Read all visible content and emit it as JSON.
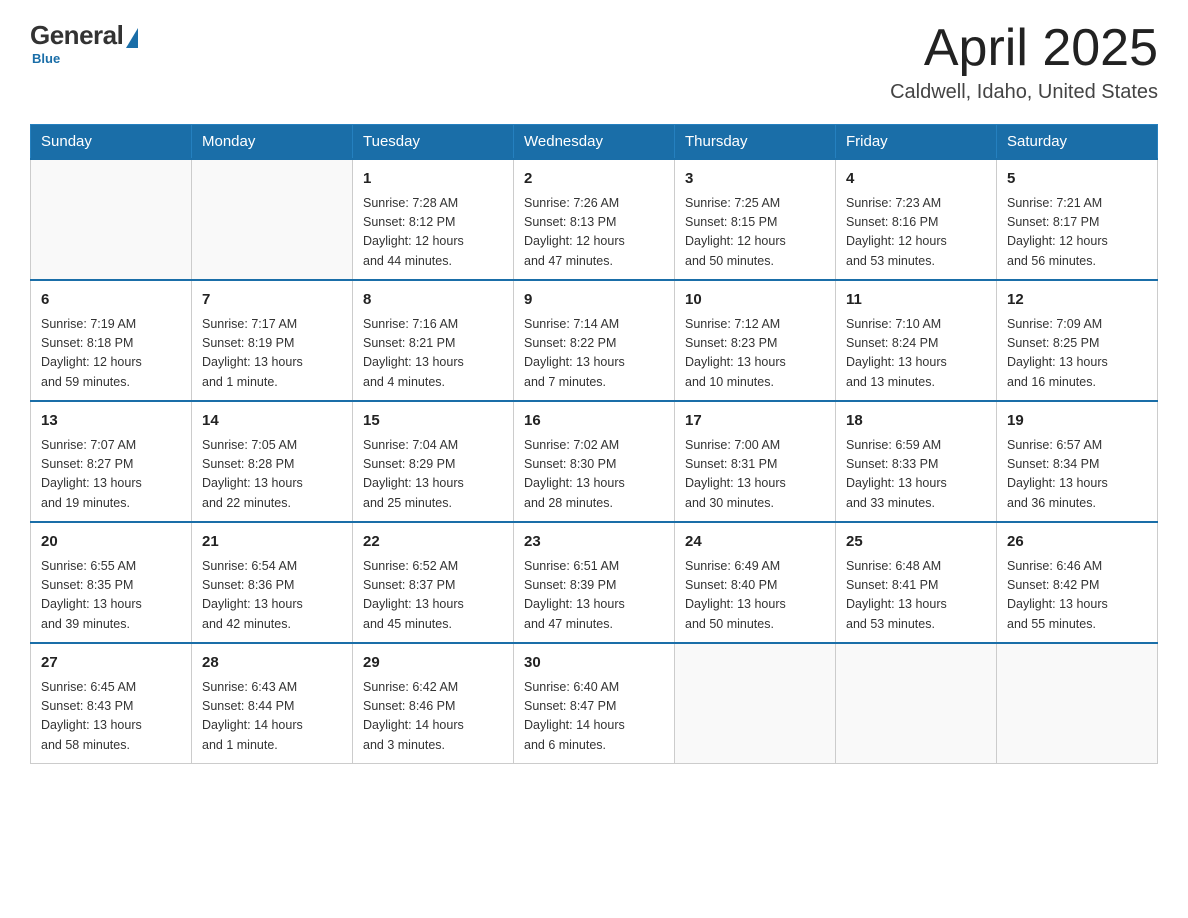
{
  "logo": {
    "general": "General",
    "blue": "Blue",
    "subtitle": "Blue"
  },
  "title": {
    "month_year": "April 2025",
    "location": "Caldwell, Idaho, United States"
  },
  "headers": [
    "Sunday",
    "Monday",
    "Tuesday",
    "Wednesday",
    "Thursday",
    "Friday",
    "Saturday"
  ],
  "weeks": [
    [
      {
        "day": "",
        "info": ""
      },
      {
        "day": "",
        "info": ""
      },
      {
        "day": "1",
        "info": "Sunrise: 7:28 AM\nSunset: 8:12 PM\nDaylight: 12 hours\nand 44 minutes."
      },
      {
        "day": "2",
        "info": "Sunrise: 7:26 AM\nSunset: 8:13 PM\nDaylight: 12 hours\nand 47 minutes."
      },
      {
        "day": "3",
        "info": "Sunrise: 7:25 AM\nSunset: 8:15 PM\nDaylight: 12 hours\nand 50 minutes."
      },
      {
        "day": "4",
        "info": "Sunrise: 7:23 AM\nSunset: 8:16 PM\nDaylight: 12 hours\nand 53 minutes."
      },
      {
        "day": "5",
        "info": "Sunrise: 7:21 AM\nSunset: 8:17 PM\nDaylight: 12 hours\nand 56 minutes."
      }
    ],
    [
      {
        "day": "6",
        "info": "Sunrise: 7:19 AM\nSunset: 8:18 PM\nDaylight: 12 hours\nand 59 minutes."
      },
      {
        "day": "7",
        "info": "Sunrise: 7:17 AM\nSunset: 8:19 PM\nDaylight: 13 hours\nand 1 minute."
      },
      {
        "day": "8",
        "info": "Sunrise: 7:16 AM\nSunset: 8:21 PM\nDaylight: 13 hours\nand 4 minutes."
      },
      {
        "day": "9",
        "info": "Sunrise: 7:14 AM\nSunset: 8:22 PM\nDaylight: 13 hours\nand 7 minutes."
      },
      {
        "day": "10",
        "info": "Sunrise: 7:12 AM\nSunset: 8:23 PM\nDaylight: 13 hours\nand 10 minutes."
      },
      {
        "day": "11",
        "info": "Sunrise: 7:10 AM\nSunset: 8:24 PM\nDaylight: 13 hours\nand 13 minutes."
      },
      {
        "day": "12",
        "info": "Sunrise: 7:09 AM\nSunset: 8:25 PM\nDaylight: 13 hours\nand 16 minutes."
      }
    ],
    [
      {
        "day": "13",
        "info": "Sunrise: 7:07 AM\nSunset: 8:27 PM\nDaylight: 13 hours\nand 19 minutes."
      },
      {
        "day": "14",
        "info": "Sunrise: 7:05 AM\nSunset: 8:28 PM\nDaylight: 13 hours\nand 22 minutes."
      },
      {
        "day": "15",
        "info": "Sunrise: 7:04 AM\nSunset: 8:29 PM\nDaylight: 13 hours\nand 25 minutes."
      },
      {
        "day": "16",
        "info": "Sunrise: 7:02 AM\nSunset: 8:30 PM\nDaylight: 13 hours\nand 28 minutes."
      },
      {
        "day": "17",
        "info": "Sunrise: 7:00 AM\nSunset: 8:31 PM\nDaylight: 13 hours\nand 30 minutes."
      },
      {
        "day": "18",
        "info": "Sunrise: 6:59 AM\nSunset: 8:33 PM\nDaylight: 13 hours\nand 33 minutes."
      },
      {
        "day": "19",
        "info": "Sunrise: 6:57 AM\nSunset: 8:34 PM\nDaylight: 13 hours\nand 36 minutes."
      }
    ],
    [
      {
        "day": "20",
        "info": "Sunrise: 6:55 AM\nSunset: 8:35 PM\nDaylight: 13 hours\nand 39 minutes."
      },
      {
        "day": "21",
        "info": "Sunrise: 6:54 AM\nSunset: 8:36 PM\nDaylight: 13 hours\nand 42 minutes."
      },
      {
        "day": "22",
        "info": "Sunrise: 6:52 AM\nSunset: 8:37 PM\nDaylight: 13 hours\nand 45 minutes."
      },
      {
        "day": "23",
        "info": "Sunrise: 6:51 AM\nSunset: 8:39 PM\nDaylight: 13 hours\nand 47 minutes."
      },
      {
        "day": "24",
        "info": "Sunrise: 6:49 AM\nSunset: 8:40 PM\nDaylight: 13 hours\nand 50 minutes."
      },
      {
        "day": "25",
        "info": "Sunrise: 6:48 AM\nSunset: 8:41 PM\nDaylight: 13 hours\nand 53 minutes."
      },
      {
        "day": "26",
        "info": "Sunrise: 6:46 AM\nSunset: 8:42 PM\nDaylight: 13 hours\nand 55 minutes."
      }
    ],
    [
      {
        "day": "27",
        "info": "Sunrise: 6:45 AM\nSunset: 8:43 PM\nDaylight: 13 hours\nand 58 minutes."
      },
      {
        "day": "28",
        "info": "Sunrise: 6:43 AM\nSunset: 8:44 PM\nDaylight: 14 hours\nand 1 minute."
      },
      {
        "day": "29",
        "info": "Sunrise: 6:42 AM\nSunset: 8:46 PM\nDaylight: 14 hours\nand 3 minutes."
      },
      {
        "day": "30",
        "info": "Sunrise: 6:40 AM\nSunset: 8:47 PM\nDaylight: 14 hours\nand 6 minutes."
      },
      {
        "day": "",
        "info": ""
      },
      {
        "day": "",
        "info": ""
      },
      {
        "day": "",
        "info": ""
      }
    ]
  ]
}
